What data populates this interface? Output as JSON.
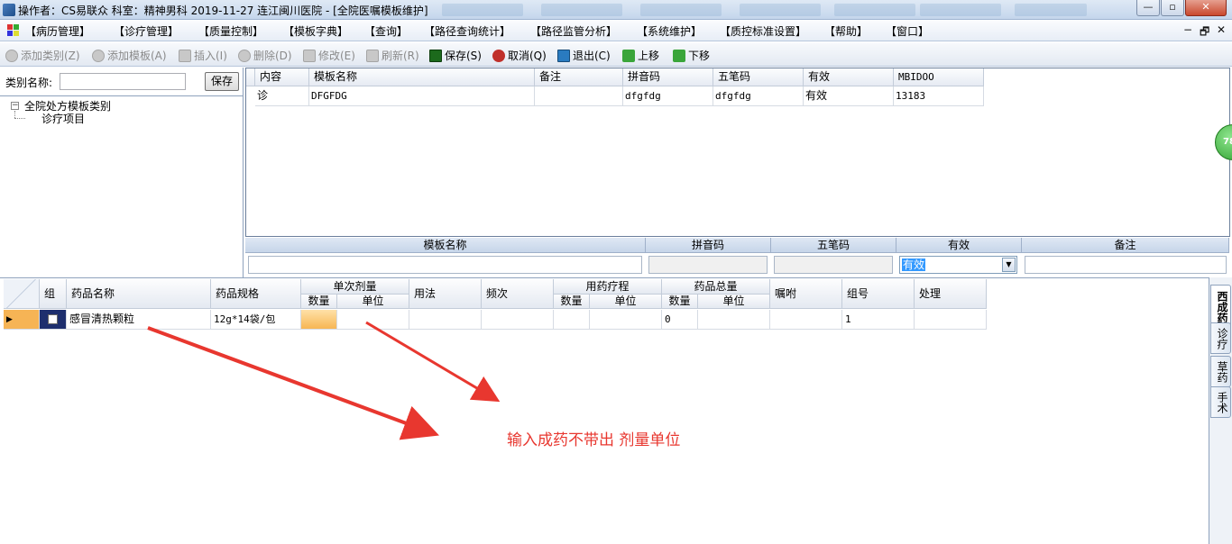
{
  "window": {
    "title": "操作者：CS易联众  科室：精神男科  2019-11-27  连江闽川医院 - [全院医嘱模板维护]",
    "controls": [
      "—",
      "▫",
      "✕"
    ]
  },
  "menu": {
    "items": [
      "【病历管理】",
      "【诊疗管理】",
      "【质量控制】",
      "【模板字典】",
      "【查询】",
      "【路径查询统计】",
      "【路径监管分析】",
      "【系统维护】",
      "【质控标准设置】",
      "【帮助】",
      "【窗口】"
    ],
    "mdi_controls": [
      "−",
      "🗗",
      "✕"
    ]
  },
  "toolbar": {
    "add_category": "添加类别(Z)",
    "add_template": "添加模板(A)",
    "insert": "插入(I)",
    "delete": "删除(D)",
    "modify": "修改(E)",
    "refresh": "刷新(R)",
    "save": "保存(S)",
    "cancel": "取消(Q)",
    "exit": "退出(C)",
    "move_up": "上移",
    "move_down": "下移"
  },
  "left_panel": {
    "category_label": "类别名称:",
    "category_value": "",
    "save_button": "保存",
    "tree": {
      "root": "全院处方模板类别",
      "child": "诊疗项目",
      "toggle": "−"
    }
  },
  "template_grid": {
    "headers": [
      "内容",
      "模板名称",
      "备注",
      "拼音码",
      "五笔码",
      "有效",
      "MBIDOO"
    ],
    "rows": [
      [
        "诊",
        "DFGFDG",
        "",
        "dfgfdg",
        "dfgfdg",
        "有效",
        "13183"
      ]
    ]
  },
  "edit_form": {
    "headers": [
      "模板名称",
      "拼音码",
      "五笔码",
      "有效",
      "备注"
    ],
    "valid_value": "有效"
  },
  "drug_grid": {
    "headers": {
      "group": "组",
      "drug_name": "药品名称",
      "spec": "药品规格",
      "single_dose": "单次剂量",
      "qty": "数量",
      "unit": "单位",
      "usage": "用法",
      "frequency": "频次",
      "course": "用药疗程",
      "total": "药品总量",
      "advice": "嘱咐",
      "group_no": "组号",
      "handle": "处理"
    },
    "row": {
      "drug_name": "感冒清热颗粒",
      "spec": "12g*14袋/包",
      "dose_qty": "",
      "dose_unit": "",
      "usage": "",
      "frequency": "",
      "course_qty": "",
      "course_unit": "",
      "total_qty": "0",
      "total_unit": "",
      "advice": "",
      "group_no": "1",
      "handle": ""
    }
  },
  "side_tabs": [
    "西成药",
    "诊疗",
    "草药",
    "手术"
  ],
  "floating_badge": "78",
  "annotation": "输入成药不带出  剂量单位",
  "colors": {
    "accent": "#3399ff",
    "annotation": "#e8372f",
    "header_blue": "#c6d5e9",
    "selected_row": "#f6b455"
  }
}
